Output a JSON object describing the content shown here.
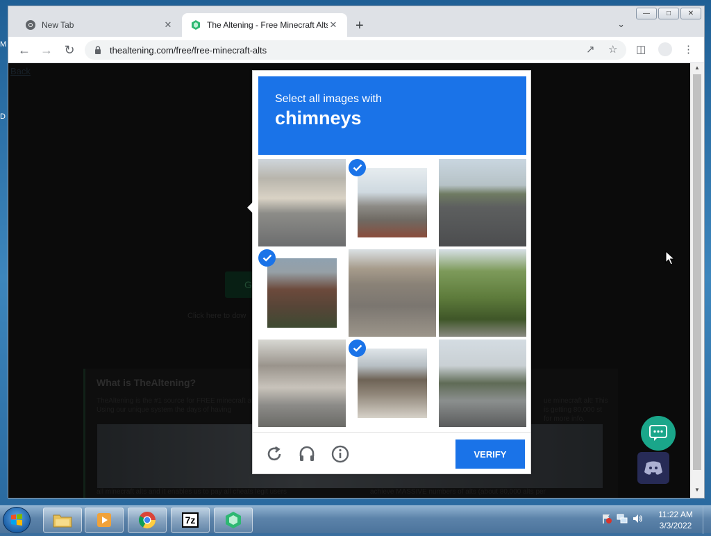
{
  "desktop": {
    "icon_letters": [
      "M",
      "D"
    ]
  },
  "browser": {
    "tabs": [
      {
        "title": "New Tab",
        "active": false
      },
      {
        "title": "The Altening - Free Minecraft Alts",
        "active": true
      }
    ],
    "url": "thealtening.com/free/free-minecraft-alts"
  },
  "page": {
    "back_link": "Back",
    "ghost_button": "G",
    "ghost_text": "Click here to dow",
    "info_title": "What is TheAltening?",
    "info_body_1": "TheAltening is the #1 source for FREE minecraft alts.",
    "info_body_2": "Using our unique system the days of having",
    "info_body_right_1": "ue minecraft alt! This",
    "info_body_right_2": "is getting 80,000 st",
    "info_body_right_3": "for more info.",
    "info_bottom_left": "all minecraft alts and it enables us to pay all cheats legit users",
    "info_bottom_right": "achieve MASSIVE numbers of alts (about 80,000 alts per"
  },
  "captcha": {
    "prompt": "Select all images with",
    "target": "chimneys",
    "verify_label": "VERIFY",
    "tiles_selected": [
      false,
      true,
      false,
      true,
      false,
      false,
      false,
      true,
      false
    ]
  },
  "taskbar": {
    "time": "11:22 AM",
    "date": "3/3/2022",
    "apps": [
      "explorer",
      "media-player",
      "chrome",
      "7zip",
      "altening"
    ],
    "app_7zip_label": "7z"
  },
  "colors": {
    "accent": "#1a73e8",
    "chat": "#1aa68a"
  }
}
